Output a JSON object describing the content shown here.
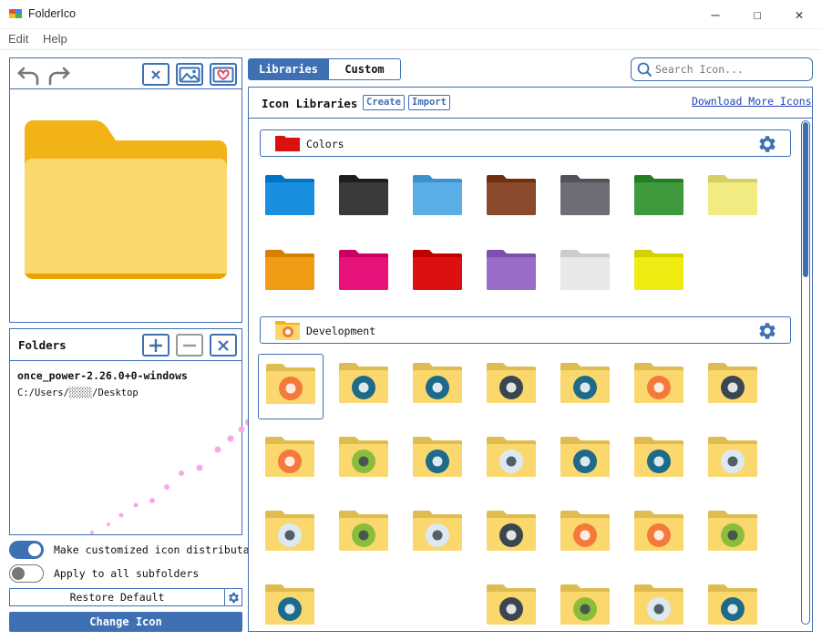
{
  "app": {
    "title": "FolderIco"
  },
  "menu": {
    "edit": "Edit",
    "help": "Help"
  },
  "folders": {
    "title": "Folders",
    "items": [
      {
        "name": "once_power-2.26.0+0-windows",
        "path": "C:/Users/░░░░/Desktop"
      }
    ]
  },
  "options": {
    "distributable_label": "Make customized icon distributable",
    "distributable_on": true,
    "subfolders_label": "Apply to all subfolders",
    "subfolders_on": false
  },
  "buttons": {
    "restore": "Restore Default",
    "change": "Change Icon"
  },
  "tabs": [
    {
      "label": "Libraries",
      "active": true
    },
    {
      "label": "Custom",
      "active": false
    }
  ],
  "search": {
    "placeholder": "Search Icon..."
  },
  "library": {
    "title": "Icon Libraries",
    "create": "Create",
    "import": "Import",
    "download": "Download More Icons",
    "sections": [
      {
        "name": "Colors"
      },
      {
        "name": "Development"
      }
    ],
    "color_folders": [
      "#1a8fe0",
      "#3a3a3a",
      "#5aaee6",
      "#8b4a2b",
      "#6d6d75",
      "#3e9a3c",
      "#f0ec82",
      "#f29c16",
      "#e8137a",
      "#dd1010",
      "#9a6cc9",
      "#e8e8e8",
      "#f0eb10"
    ],
    "dev_icons": [
      {
        "icon": "alarm-clock",
        "bg": "#f47a3c"
      },
      {
        "icon": "ruler-pencil",
        "bg": "#1d6a8a"
      },
      {
        "icon": "sun",
        "bg": "#1d6a8a"
      },
      {
        "icon": "camera",
        "bg": "#3a4650"
      },
      {
        "icon": "note-pen",
        "bg": "#1d6a8a"
      },
      {
        "icon": "cloud",
        "bg": "#f47a3c"
      },
      {
        "icon": "gear",
        "bg": "#3a4650"
      },
      {
        "icon": "stopwatch",
        "bg": "#f47a3c"
      },
      {
        "icon": "presentation",
        "bg": "#8bbd3c"
      },
      {
        "icon": "easel-chart",
        "bg": "#1d6a8a"
      },
      {
        "icon": "traffic-cone",
        "bg": "#dde9f0"
      },
      {
        "icon": "crown",
        "bg": "#1d6a8a"
      },
      {
        "icon": "diamond",
        "bg": "#1d6a8a"
      },
      {
        "icon": "dice",
        "bg": "#dde9f0"
      },
      {
        "icon": "tools-cross",
        "bg": "#dde9f0"
      },
      {
        "icon": "puzzle-head",
        "bg": "#8bbd3c"
      },
      {
        "icon": "factory",
        "bg": "#dde9f0"
      },
      {
        "icon": "flask",
        "bg": "#3a4650"
      },
      {
        "icon": "gamepad",
        "bg": "#f47a3c"
      },
      {
        "icon": "sitemap",
        "bg": "#f47a3c"
      },
      {
        "icon": "bug",
        "bg": "#8bbd3c"
      },
      {
        "icon": "monitor-chart",
        "bg": "#1d6a8a"
      },
      {
        "icon": "blank",
        "bg": "#ffffff"
      },
      {
        "icon": "blank",
        "bg": "#ffffff"
      },
      {
        "icon": "links",
        "bg": "#3a4650"
      },
      {
        "icon": "gear-light",
        "bg": "#8bbd3c"
      },
      {
        "icon": "microscope",
        "bg": "#dde9f0"
      },
      {
        "icon": "dropbox",
        "bg": "#1d6a8a"
      }
    ]
  }
}
